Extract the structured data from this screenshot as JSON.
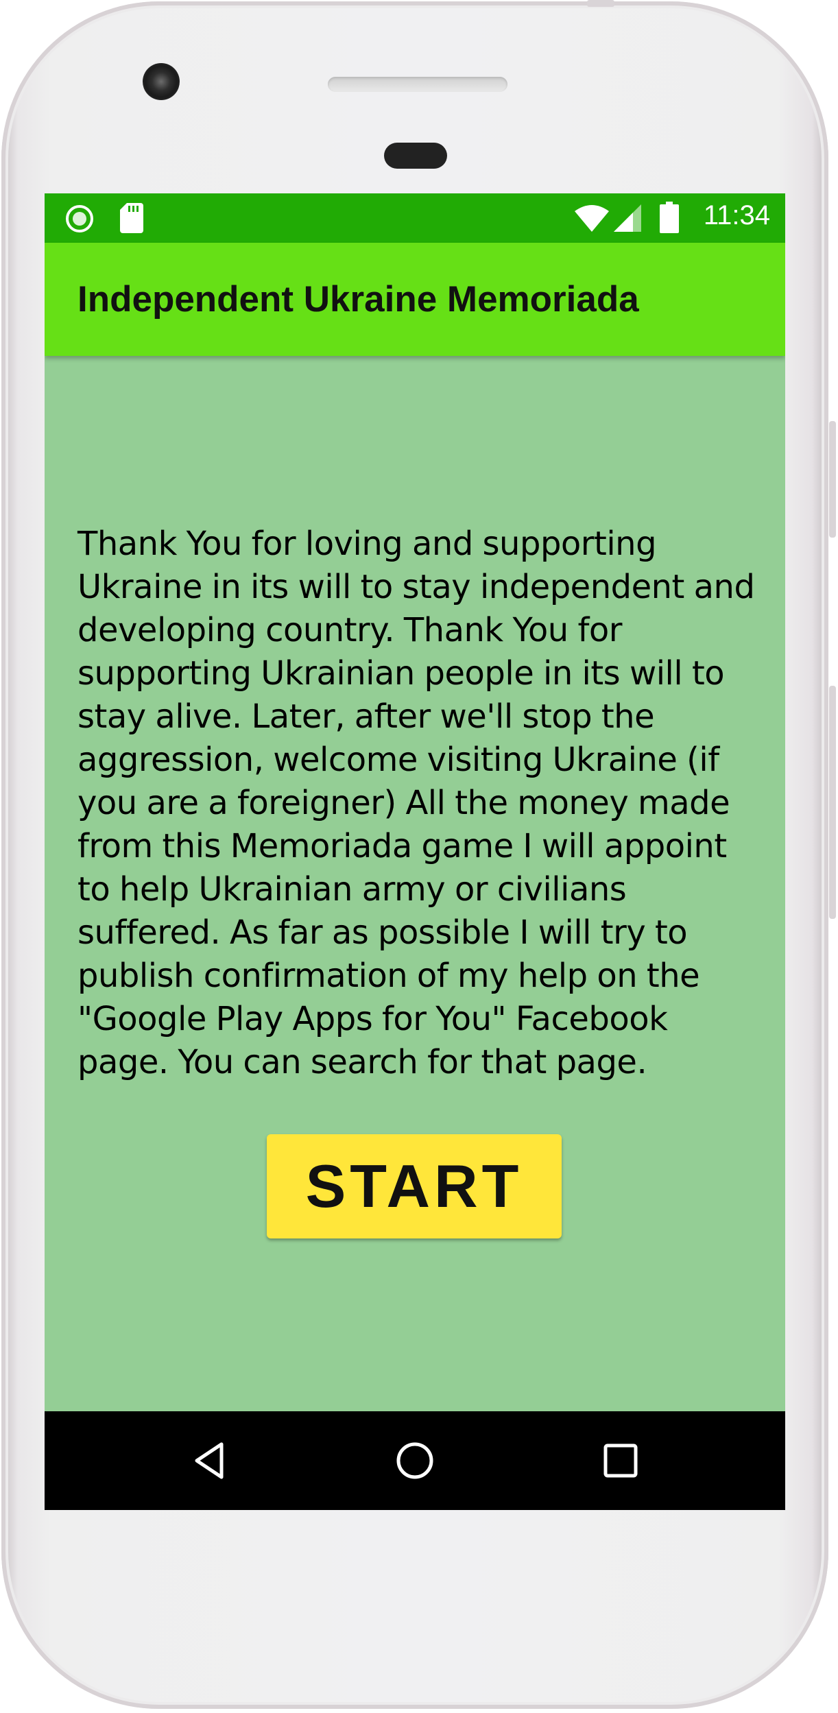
{
  "status_bar": {
    "time": "11:34",
    "icons": [
      "record-icon",
      "sd-card-icon",
      "wifi-icon",
      "signal-icon",
      "battery-icon"
    ]
  },
  "app_bar": {
    "title": "Independent Ukraine Memoriada"
  },
  "main": {
    "message": "Thank You for loving and supporting Ukraine in its will to stay independent and developing country. Thank You for supporting Ukrainian people in its will to stay alive. Later, after we'll stop the aggression, welcome visiting Ukraine (if you are a foreigner) All the money made from this Memoriada game I will appoint to help Ukrainian army or civilians suffered. As far as possible I will try to publish confirmation of my help on the \"Google Play Apps for You\" Facebook page. You can search for that page.",
    "start_label": "START"
  },
  "nav_bar": {
    "buttons": [
      "back-icon",
      "home-icon",
      "recents-icon"
    ]
  },
  "colors": {
    "status_bar": "#21ab05",
    "app_bar": "#66e016",
    "background": "#94ce95",
    "start_button": "#ffe63a",
    "nav_bar": "#000000"
  }
}
